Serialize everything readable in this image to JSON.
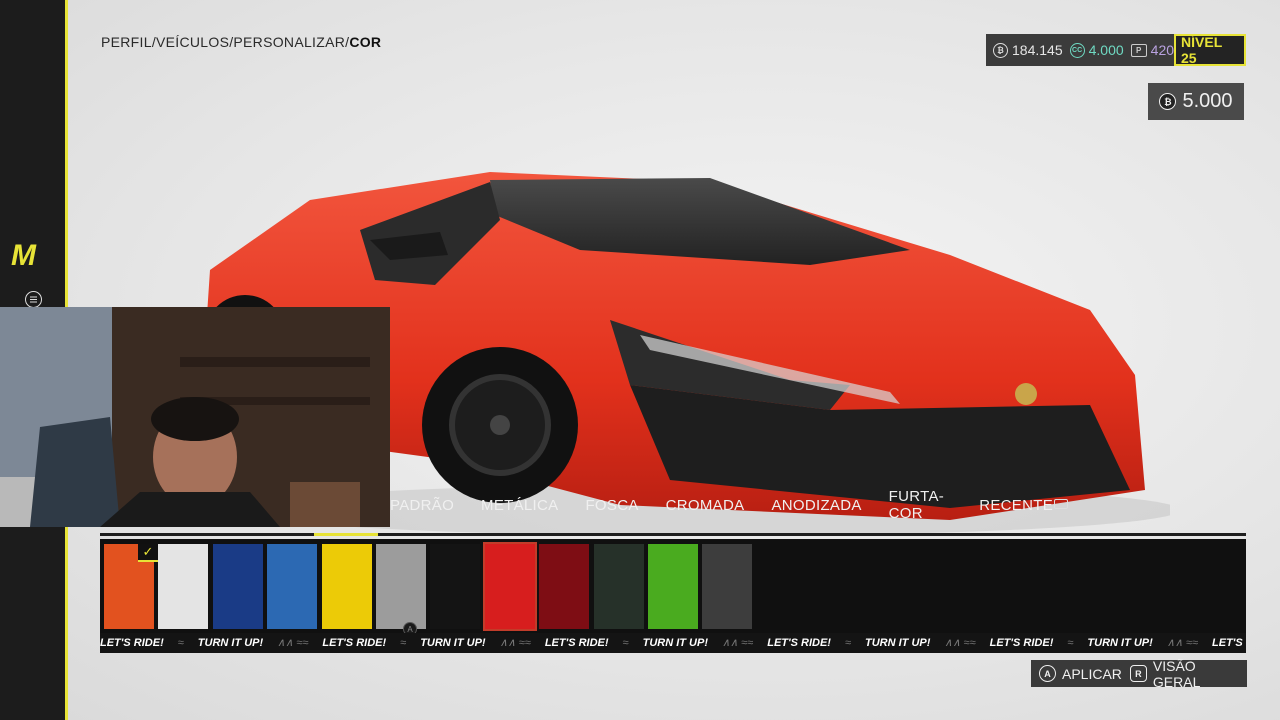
{
  "breadcrumb": {
    "path": "PERFIL/VEÍCULOS/PERSONALIZAR/",
    "current": "COR"
  },
  "wallet": {
    "credits": "184.145",
    "cc": "4.000",
    "points": "420",
    "level": "NÍVEL 25"
  },
  "price": "5.000",
  "tabs": [
    "PADRÃO",
    "METÁLICA",
    "FOSCA",
    "CROMADA",
    "ANODIZADA",
    "FURTA-COR",
    "RECENTE"
  ],
  "tab_progress": 0.056,
  "swatches": [
    {
      "color": "#e2521f",
      "checked": true
    },
    {
      "color": "#e4e4e4"
    },
    {
      "color": "#1a3b86"
    },
    {
      "color": "#2c69b3"
    },
    {
      "color": "#eccb07"
    },
    {
      "color": "#9c9c9c"
    },
    {
      "color": "#141414"
    },
    {
      "color": "#d71e1e",
      "selected": true
    },
    {
      "color": "#7e0d14"
    },
    {
      "color": "#263129"
    },
    {
      "color": "#4aab1f"
    },
    {
      "color": "#3d3d3d"
    }
  ],
  "ticker": {
    "phrase_a": "LET'S RIDE!",
    "phrase_b": "TURN IT UP!"
  },
  "actions": {
    "apply_label": "APLICAR",
    "overview_label": "VISÃO GERAL"
  },
  "colors": {
    "accent": "#e7e337",
    "car": "#e4331f"
  }
}
